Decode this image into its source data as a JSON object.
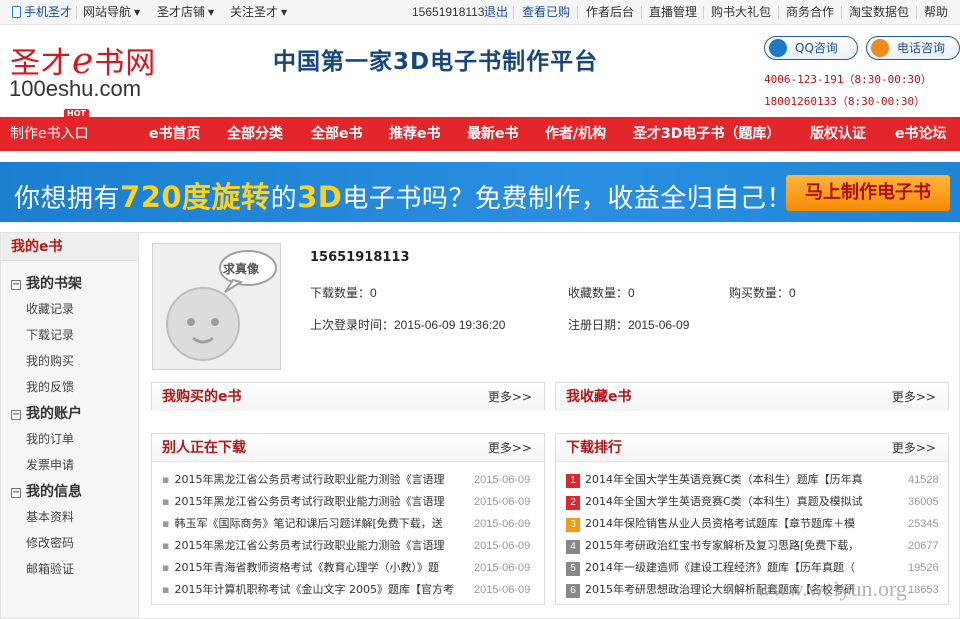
{
  "topbar": {
    "mobile": "手机圣才",
    "site_nav": "网站导航",
    "shop": "圣才店铺",
    "follow": "关注圣才",
    "caret": "▼",
    "user": "15651918113",
    "logout": "退出",
    "purchased": "查看已购",
    "author_admin": "作者后台",
    "live": "直播管理",
    "gift": "购书大礼包",
    "business": "商务合作",
    "taobao": "淘宝数据包",
    "help": "帮助"
  },
  "header": {
    "logo_cn_a": "圣才",
    "logo_cn_e": "e",
    "logo_cn_b": "书网",
    "logo_en": "100eshu.com",
    "slogan": "中国第一家3D电子书制作平台",
    "qq": "QQ咨询",
    "tel": "电话咨询",
    "hotline1": "4006-123-191（8:30-00:30）",
    "hotline2": "18001260133（8:30-00:30）"
  },
  "nav": {
    "entry": "制作e书入口",
    "hot": "HOT",
    "items": [
      "e书首页",
      "全部分类",
      "全部e书",
      "推荐e书",
      "最新e书",
      "作者/机构",
      "圣才3D电子书（题库）",
      "版权认证",
      "e书论坛"
    ]
  },
  "banner": {
    "t1": "你想拥有",
    "t2": "720度旋转",
    "t3": "的",
    "t4": "3D",
    "t5": "电子书吗？免费制作，收益全归自己！",
    "cta": "马上制作电子书"
  },
  "sidebar": {
    "title": "我的e书",
    "g1": "我的书架",
    "g1_items": [
      "收藏记录",
      "下载记录",
      "我的购买",
      "我的反馈"
    ],
    "g2": "我的账户",
    "g2_items": [
      "我的订单",
      "发票申请"
    ],
    "g3": "我的信息",
    "g3_items": [
      "基本资料",
      "修改密码",
      "邮箱验证"
    ],
    "box": "−"
  },
  "profile": {
    "avatar_text": "求真像",
    "username": "15651918113",
    "downloads": "下载数量：0",
    "favorites": "收藏数量：0",
    "purchases": "购买数量：0",
    "last_login": "上次登录时间：2015-06-09 19:36:20",
    "registered": "注册日期：2015-06-09"
  },
  "panels": {
    "more": "更多>>",
    "bought": "我购买的e书",
    "collected": "我收藏e书",
    "downloading": "别人正在下载",
    "ranking": "下载排行"
  },
  "downloading_list": [
    {
      "title": "2015年黑龙江省公务员考试行政职业能力测验《言语理",
      "date": "2015-06-09"
    },
    {
      "title": "2015年黑龙江省公务员考试行政职业能力测验《言语理",
      "date": "2015-06-09"
    },
    {
      "title": "韩玉军《国际商务》笔记和课后习题详解[免费下载，送",
      "date": "2015-06-09"
    },
    {
      "title": "2015年黑龙江省公务员考试行政职业能力测验《言语理",
      "date": "2015-06-09"
    },
    {
      "title": "2015年青海省教师资格考试《教育心理学（小教）》题",
      "date": "2015-06-09"
    },
    {
      "title": "2015年计算机职称考试《金山文字 2005》题库【官方考",
      "date": "2015-06-09"
    }
  ],
  "ranking_list": [
    {
      "rank": "1",
      "title": "2014年全国大学生英语竞赛C类（本科生）题库【历年真",
      "count": "41528"
    },
    {
      "rank": "2",
      "title": "2014年全国大学生英语竞赛C类（本科生）真题及模拟试",
      "count": "36005"
    },
    {
      "rank": "3",
      "title": "2014年保险销售从业人员资格考试题库【章节题库＋模",
      "count": "25345"
    },
    {
      "rank": "4",
      "title": "2015年考研政治红宝书专家解析及复习思路[免费下载，",
      "count": "20677"
    },
    {
      "rank": "5",
      "title": "2014年一级建造师《建设工程经济》题库【历年真题（",
      "count": "19526"
    },
    {
      "rank": "6",
      "title": "2015年考研思想政治理论大纲解析配套题库【名校考研",
      "count": "18653"
    }
  ],
  "colors": {
    "nav_red": "#e2262a",
    "rank_top": "#e2262a",
    "rank_mid": "#f39c12",
    "rank_other": "#888888"
  },
  "watermark": "www.weiyun.org"
}
